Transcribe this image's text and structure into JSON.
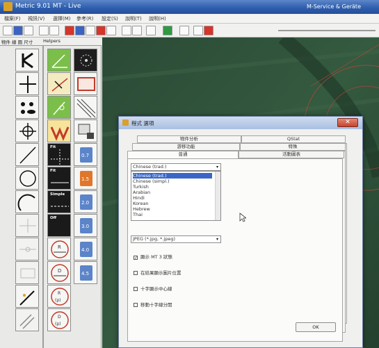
{
  "window": {
    "title": "Metric 9.01 MT - Live",
    "company": "M-Service & Geräte"
  },
  "menu": [
    "檔案(F)",
    "視訊(V)",
    "選擇(M)",
    "參考(R)",
    "設定(S)",
    "說明(T)",
    "說明(H)"
  ],
  "palette": {
    "headers": [
      "物件 線 圓 尺寸",
      "Helpers"
    ],
    "labels": {
      "fit": "Fit",
      "fit2": "Fit",
      "simple": "Simple",
      "off": "Off",
      "zoom": [
        "0.7",
        "1.5",
        "2.0",
        "3.0",
        "4.0",
        "4.5"
      ],
      "r": "R",
      "d": "D",
      "p": "(p)"
    }
  },
  "dialog": {
    "title": "程式 選項",
    "tabs_row1": [
      "物件分析",
      "QStat"
    ],
    "tabs_row2": [
      "游移功能",
      "特殊"
    ],
    "tabs_row3": [
      "普通",
      "活動圖表"
    ],
    "language_value": "Chinese (trad.)",
    "language_options": [
      "Chinese (trad.)",
      "Chinese (simpl.)",
      "Turkish",
      "Arabian",
      "Hindi",
      "Korean",
      "Hebrew",
      "Thai"
    ],
    "selected_language_index": 0,
    "image_format": "JPEG (*.jpg, *.jpeg)",
    "checkboxes": [
      {
        "label": "顯示 MT 3 狀態",
        "checked": true
      },
      {
        "label": "在結果顯示圖片位置",
        "checked": false
      },
      {
        "label": "十字顯示中心線",
        "checked": false
      },
      {
        "label": "移動十字線分開",
        "checked": false
      }
    ],
    "ok_label": "OK",
    "close_glyph": "✕"
  },
  "colors": {
    "accent": "#3a66c7",
    "image_bg": "#2d4734",
    "close": "#c5432d"
  }
}
